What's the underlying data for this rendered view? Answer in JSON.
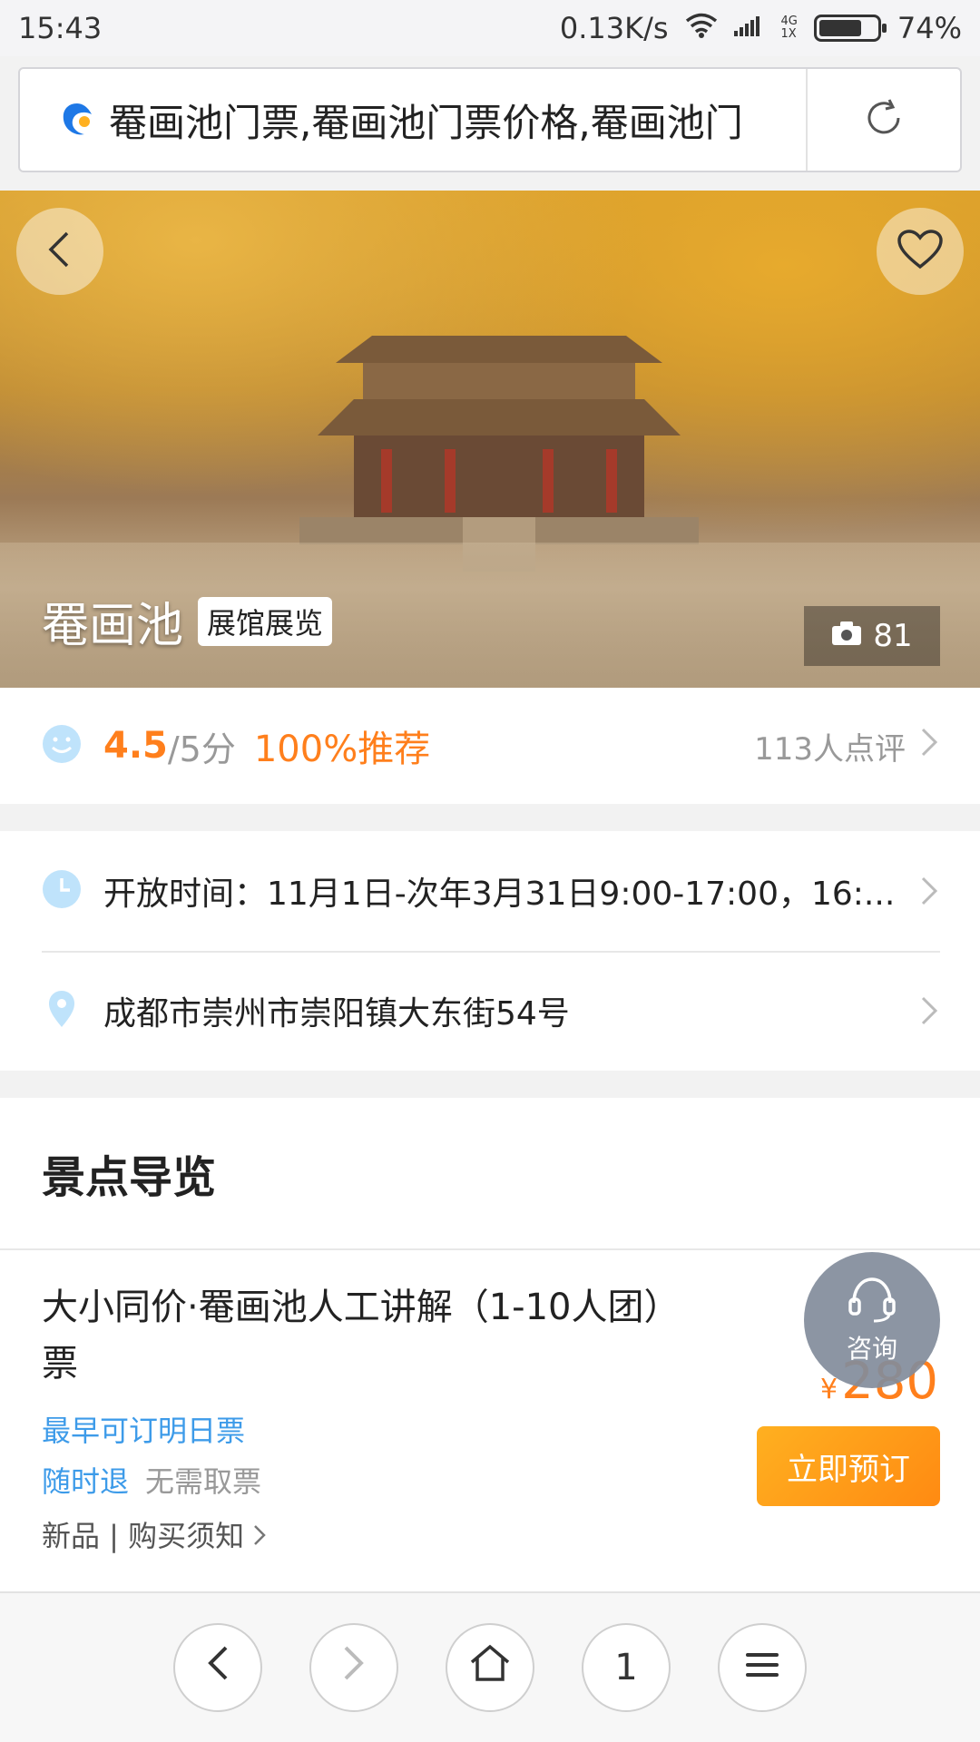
{
  "status": {
    "time": "15:43",
    "speed": "0.13K/s",
    "net_top": "4G",
    "net_bottom": "1X",
    "battery": "74%",
    "battery_level": 0.74
  },
  "urlbar": {
    "title": "罨画池门票,罨画池门票价格,罨画池门"
  },
  "hero": {
    "name": "罨画池",
    "tag": "展馆展览",
    "photo_count": "81"
  },
  "rating": {
    "score": "4.5",
    "scale": "/5分",
    "recommend": "100%推荐",
    "reviews": "113人点评"
  },
  "info": {
    "hours": "开放时间：11月1日-次年3月31日9:00-17:00，16:...",
    "address": "成都市崇州市崇阳镇大东街54号"
  },
  "guide": {
    "title": "景点导览",
    "ticket_name": "大小同价·罨画池人工讲解（1-10人团）票",
    "earliest": "最早可订明日票",
    "refund": "随时退",
    "no_ticket": "无需取票",
    "notice": "新品 | 购买须知",
    "price_symbol": "¥",
    "price": "280",
    "book": "立即预订",
    "consult": "咨询"
  },
  "bottomnav": {
    "tabs_count": "1"
  },
  "colors": {
    "accent_orange": "#ff7f1c",
    "link_blue": "#3d9be9"
  }
}
